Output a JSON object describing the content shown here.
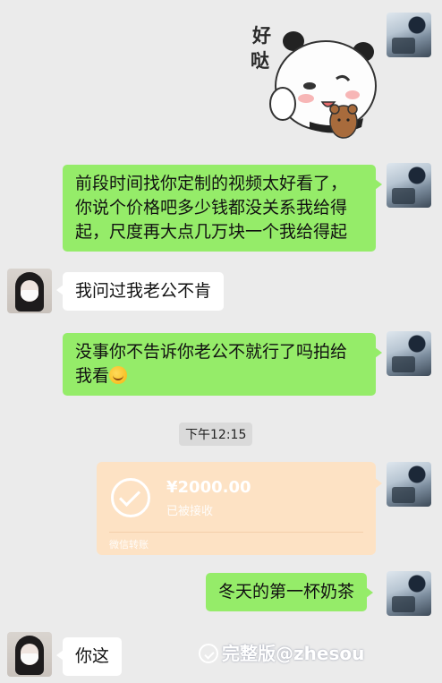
{
  "sticker": {
    "line1": "好",
    "line2": "哒"
  },
  "messages": [
    {
      "text": "前段时间找你定制的视频太好看了，你说个价格吧多少钱都没关系我给得起，尺度再大点几万块一个我给得起"
    },
    {
      "text": "我问过我老公不肯"
    },
    {
      "text": "没事你不告诉你老公不就行了吗拍给我看"
    },
    {
      "text": "冬天的第一杯奶茶"
    },
    {
      "text": "你这"
    }
  ],
  "timestamp": "下午12:15",
  "transfer": {
    "amount": "¥2000.00",
    "status": "已被接收",
    "footer": "微信转账",
    "color": "#fde2c4"
  },
  "watermark": {
    "text": "完整版@zhesou"
  },
  "colors": {
    "background": "#ebebeb",
    "sent_bubble": "#95ec69",
    "received_bubble": "#ffffff"
  }
}
